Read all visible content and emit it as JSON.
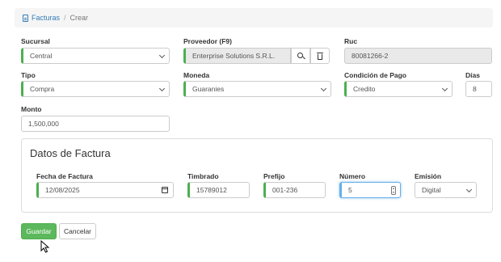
{
  "breadcrumb": {
    "root": "Facturas",
    "separator": "/",
    "current": "Crear"
  },
  "form": {
    "sucursal": {
      "label": "Sucursal",
      "value": "Central"
    },
    "proveedor": {
      "label": "Proveedor (F9)",
      "value": "Enterprise Solutions S.R.L."
    },
    "ruc": {
      "label": "Ruc",
      "value": "80081266-2"
    },
    "tipo": {
      "label": "Tipo",
      "value": "Compra"
    },
    "moneda": {
      "label": "Moneda",
      "value": "Guaranies"
    },
    "condicion": {
      "label": "Condición de Pago",
      "value": "Credito"
    },
    "dias": {
      "label": "Días",
      "value": "8"
    },
    "monto": {
      "label": "Monto",
      "value": "1,500,000"
    }
  },
  "factura": {
    "title": "Datos de Factura",
    "fecha": {
      "label": "Fecha de Factura",
      "value": "12/08/2025"
    },
    "timbrado": {
      "label": "Timbrado",
      "value": "15789012"
    },
    "prefijo": {
      "label": "Prefijo",
      "value": "001-236"
    },
    "numero": {
      "label": "Número",
      "value": "5"
    },
    "emision": {
      "label": "Emisión",
      "value": "Digital"
    }
  },
  "actions": {
    "save": "Guardar",
    "cancel": "Cancelar"
  },
  "colors": {
    "accent_green": "#4caf50",
    "primary_button": "#5cb85c",
    "link": "#337ab7",
    "focus_border": "#66afe9"
  }
}
